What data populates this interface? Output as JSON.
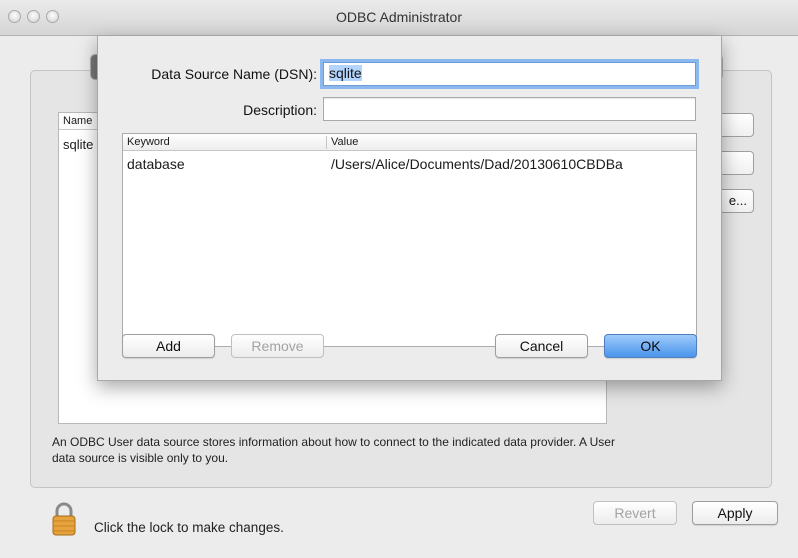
{
  "window": {
    "title": "ODBC Administrator"
  },
  "background": {
    "list_header": "Name",
    "list_row": "sqlite",
    "side_button_label": "e...",
    "info_text": "An ODBC User data source stores information about how to connect to the indicated data provider. A User data source is visible only to you.",
    "lock_text": "Click the lock to make changes.",
    "revert_label": "Revert",
    "apply_label": "Apply"
  },
  "dialog": {
    "dsn_label": "Data Source Name (DSN):",
    "dsn_value": "sqlite",
    "description_label": "Description:",
    "description_value": "",
    "table": {
      "columns": [
        "Keyword",
        "Value"
      ],
      "rows": [
        {
          "keyword": "database",
          "value": "/Users/Alice/Documents/Dad/20130610CBDBa"
        }
      ]
    },
    "add_label": "Add",
    "remove_label": "Remove",
    "cancel_label": "Cancel",
    "ok_label": "OK"
  },
  "colors": {
    "accent": "#4a93ec",
    "selection": "#b3d4fc"
  }
}
